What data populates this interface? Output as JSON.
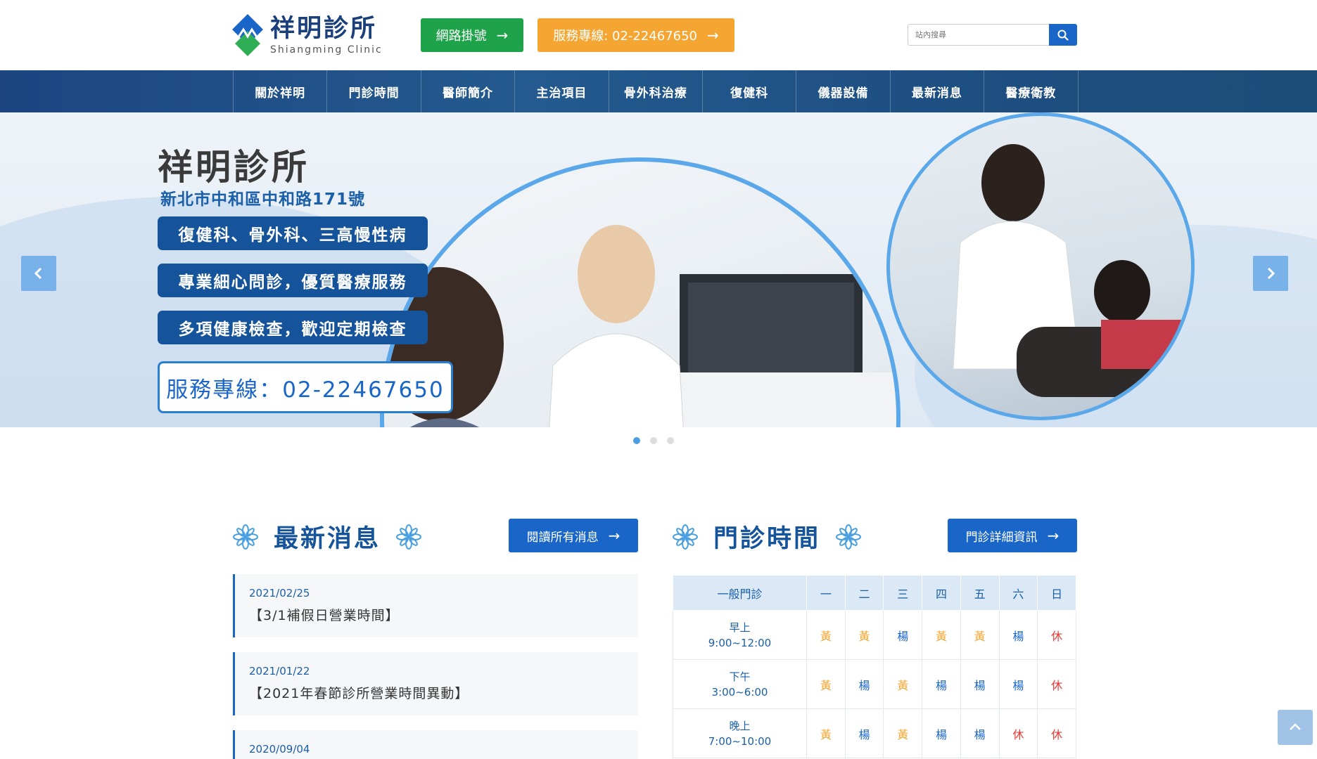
{
  "header": {
    "logo_name": "祥明診所",
    "logo_sub": "Shiangming Clinic",
    "online_button": "網路掛號",
    "hotline_button": "服務專線: 02-22467650",
    "search_placeholder": "站內搜尋"
  },
  "nav": {
    "items": [
      {
        "label": "關於祥明"
      },
      {
        "label": "門診時間"
      },
      {
        "label": "醫師簡介"
      },
      {
        "label": "主治項目"
      },
      {
        "label": "骨外科治療"
      },
      {
        "label": "復健科"
      },
      {
        "label": "儀器設備"
      },
      {
        "label": "最新消息"
      },
      {
        "label": "醫療衛教"
      }
    ]
  },
  "banner": {
    "title": "祥明診所",
    "address": "新北市中和區中和路171號",
    "pills": [
      "復健科、骨外科、三高慢性病",
      "專業細心問診，優質醫療服務",
      "多項健康檢查，歡迎定期檢查"
    ],
    "hotline": "服務專線：02-22467650",
    "active_slide": 1,
    "slide_count": 3
  },
  "news": {
    "title": "最新消息",
    "read_all": "閱讀所有消息",
    "items": [
      {
        "date": "2021/02/25",
        "title": "【3/1補假日營業時間】"
      },
      {
        "date": "2021/01/22",
        "title": "【2021年春節診所營業時間異動】"
      },
      {
        "date": "2020/09/04",
        "title": ""
      }
    ]
  },
  "schedule": {
    "title": "門診時間",
    "detail_button": "門診詳細資訊",
    "header": [
      "一般門診",
      "一",
      "二",
      "三",
      "四",
      "五",
      "六",
      "日"
    ],
    "rows": [
      {
        "period": "早上",
        "time": "9:00~12:00",
        "cells": [
          "黃",
          "黃",
          "楊",
          "黃",
          "黃",
          "楊",
          "休"
        ]
      },
      {
        "period": "下午",
        "time": "3:00~6:00",
        "cells": [
          "黃",
          "楊",
          "黃",
          "楊",
          "楊",
          "楊",
          "休"
        ]
      },
      {
        "period": "晚上",
        "time": "7:00~10:00",
        "cells": [
          "黃",
          "楊",
          "黃",
          "楊",
          "楊",
          "休",
          "休"
        ]
      }
    ]
  },
  "colors": {
    "brand_blue": "#15539a",
    "accent_blue": "#1a66c8",
    "green": "#1fa34a",
    "orange": "#f5a632",
    "red": "#e53935"
  }
}
